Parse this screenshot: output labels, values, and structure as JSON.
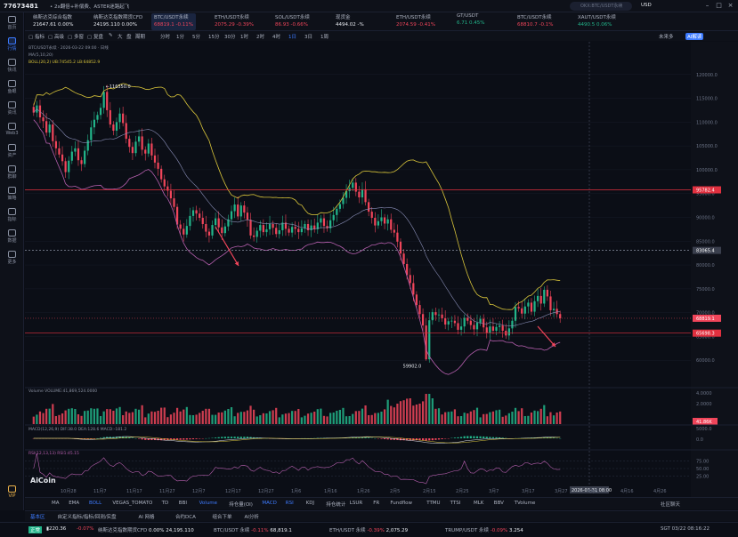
{
  "titlebar": {
    "account": "77673481",
    "notice": "• 2x翻倍+补偿费、ASTER迷路起飞",
    "search_placeholder": "OKX:BTC/USDT永续",
    "currency": "USD"
  },
  "sidebar": {
    "items": [
      {
        "label": "首页",
        "icon": "home-icon"
      },
      {
        "label": "行情",
        "icon": "chart-icon",
        "active": true
      },
      {
        "label": "快讯",
        "icon": "news-icon"
      },
      {
        "label": "鱼眼",
        "icon": "eye-icon"
      },
      {
        "label": "资讯",
        "icon": "doc-icon"
      },
      {
        "label": "Web3",
        "icon": "web3-icon"
      },
      {
        "label": "资产",
        "icon": "wallet-icon"
      },
      {
        "label": "群聊",
        "icon": "chat-icon"
      },
      {
        "label": "策略",
        "icon": "strategy-icon"
      },
      {
        "label": "指标",
        "icon": "indicator-icon"
      },
      {
        "label": "数据",
        "icon": "data-icon"
      },
      {
        "label": "更多",
        "icon": "more-icon"
      }
    ],
    "vip": "VIP"
  },
  "tickers": [
    {
      "name": "纳斯达克综合指数",
      "value": "21647.61",
      "change": "0.00%",
      "trend": "wt"
    },
    {
      "name": "纳斯达克指数期货CFD",
      "value": "24195.110",
      "change": "0.00%",
      "trend": "wt"
    },
    {
      "name": "BTC/USDT永续",
      "value": "68819.1",
      "change": "-0.11%",
      "trend": "dn",
      "active": true
    },
    {
      "name": "ETH/USDT永续",
      "value": "2075.29",
      "change": "-0.39%",
      "trend": "dn"
    },
    {
      "name": "SOL/USDT永续",
      "value": "86.93",
      "change": "-0.66%",
      "trend": "dn"
    },
    {
      "name": "现货金",
      "value": "4494.02",
      "change": "-%",
      "trend": "wt"
    },
    {
      "name": "ETH/USDT永续",
      "value": "2074.59",
      "change": "-0.41%",
      "trend": "dn"
    },
    {
      "name": "GT/USDT",
      "value": "6.71",
      "change": "0.45%",
      "trend": "up"
    },
    {
      "name": "BTC/USDT永续",
      "value": "68810.7",
      "change": "-0.1%",
      "trend": "dn"
    },
    {
      "name": "XAUT/USDT永续",
      "value": "4490.5",
      "change": "0.06%",
      "trend": "up"
    }
  ],
  "toolbar": {
    "indicators": "指标",
    "advanced": "高级",
    "multi": "多窗",
    "replay": "复盘",
    "period": "周期",
    "intervals": [
      "分时",
      "1分",
      "5分",
      "15分",
      "30分",
      "1时",
      "2时",
      "4时",
      "1日",
      "3日",
      "1周"
    ],
    "selected": "1日",
    "right_opts": [
      "未来多",
      "AI解读"
    ]
  },
  "chart": {
    "symbol_line": "BTC/USDT永续 · 2026-03-22 09:00 · 日线",
    "ma_line": "MA(5,10,20)",
    "boll_line": "BOLL(20,2) UB:74545.2 LB:64852.9",
    "price_ticks": [
      "120000.0",
      "115000.0",
      "110000.0",
      "105000.0",
      "100000.0",
      "95000.0",
      "90000.0",
      "85000.0",
      "80000.0",
      "75000.0",
      "70000.0",
      "65000.0",
      "60000.0"
    ],
    "x_ticks": [
      "10月28",
      "11月7",
      "11月17",
      "11月27",
      "12月7",
      "12月17",
      "12月27",
      "1月6",
      "1月16",
      "1月26",
      "2月5",
      "2月15",
      "2月25",
      "3月7",
      "3月17",
      "3月27",
      "4月6",
      "4月16",
      "4月26"
    ],
    "hi_label": "116350.0",
    "lo_label": "59902.0",
    "level_label_1": "95782.4",
    "level_label_2": "83065.4",
    "price_now": "68819.1",
    "level_label_3": "65698.3",
    "cursor_date": "2026-03-31 08:00",
    "volume_legend": "Volume  VOLUME:41,869,524.0000",
    "volume_ticks": [
      "4.0000",
      "2.0000"
    ],
    "volume_tag": "41.86K",
    "macd_legend": "MACD(12,26,9)  DIF:38.0  DEA:128.6  MACD:-181.2",
    "macd_ticks": [
      "5000.0",
      "0.0"
    ],
    "rsi_legend": "RSI(12,13,13)  RSI1:45.15",
    "rsi_ticks": [
      "75.00",
      "50.00",
      "25.00"
    ],
    "logo": "AiCoin",
    "watermark": "AiCoin"
  },
  "chart_data": {
    "type": "candlestick",
    "title": "BTC/USDT永续",
    "interval": "1日",
    "ylim": [
      55000,
      125000
    ],
    "closes": [
      112000,
      113500,
      111000,
      110200,
      107800,
      109500,
      106000,
      104500,
      103200,
      101800,
      99500,
      101900,
      103800,
      104500,
      102000,
      101200,
      104000,
      106200,
      108900,
      110500,
      111500,
      113000,
      116350,
      112500,
      109500,
      108200,
      110000,
      111800,
      109800,
      106500,
      104800,
      103500,
      105900,
      107000,
      104200,
      103400,
      105500,
      103000,
      101500,
      100200,
      98000,
      96500,
      95600,
      94000,
      92200,
      88500,
      87600,
      86400,
      88200,
      90300,
      91500,
      90800,
      89900,
      88600,
      87000,
      86200,
      88400,
      89800,
      87900,
      86700,
      88100,
      89600,
      91300,
      92700,
      90200,
      92500,
      91000,
      89500,
      86200,
      85900,
      87200,
      88400,
      86900,
      87500,
      88600,
      87800,
      86500,
      87300,
      88900,
      87600,
      86800,
      88000,
      87600,
      86900,
      87700,
      88600,
      87300,
      88300,
      87500,
      88900,
      89800,
      88200,
      87700,
      89400,
      90500,
      91800,
      92800,
      94100,
      95500,
      96200,
      97300,
      95400,
      94200,
      95900,
      93200,
      91200,
      89900,
      88300,
      89200,
      90000,
      88700,
      89600,
      87400,
      86800,
      84900,
      82400,
      80200,
      77900,
      76200,
      73800,
      71600,
      69700,
      67300,
      60200,
      68400,
      70100,
      69500,
      69600,
      68800,
      67500,
      68200,
      68300,
      67800,
      66400,
      67100,
      68900,
      68300,
      67400,
      66500,
      67900,
      68700,
      66900,
      65800,
      67100,
      66200,
      67000,
      67300,
      66200,
      65200,
      66700,
      68300,
      71200,
      70900,
      69800,
      71300,
      72100,
      70200,
      72400,
      73500,
      71900,
      74800,
      73400,
      70500,
      70800,
      69700,
      68819
    ],
    "hline_levels": [
      95782.4,
      83065.4,
      65698.3
    ],
    "annotations": [
      {
        "label": "116350.0",
        "kind": "high"
      },
      {
        "label": "59902.0",
        "kind": "low"
      }
    ]
  },
  "indicator_tabs": [
    "MA",
    "EMA",
    "BOLL",
    "VEGAS_TOMATO",
    "TD",
    "BBI",
    "Volume",
    "持仓量(OI)",
    "MACD",
    "RSI",
    "KDJ",
    "持仓统计",
    "LSUR",
    "FR",
    "Fundflow",
    "TTMU",
    "TTSI",
    "MLK",
    "BBV",
    "TVolume"
  ],
  "indicator_selected": [
    "BOLL",
    "Volume",
    "MACD",
    "RSI"
  ],
  "bottom_tabs": [
    "基本区",
    "自定义指标/指标/回测/实盘",
    "AI 网格",
    "合约DCA",
    "组合下单",
    "AI分析"
  ],
  "bottom_right": "社区聊天",
  "status": {
    "mode": "正常",
    "price": "220.36",
    "change": "-0.07%",
    "items": [
      {
        "name": "纳斯达克指数期货CFD",
        "change": "0.00%",
        "value": "24,195.110"
      },
      {
        "name": "BTC/USDT 永续",
        "change": "-0.11%",
        "value": "68,819.1"
      },
      {
        "name": "ETH/USDT 永续",
        "change": "-0.39%",
        "value": "2,075.29"
      },
      {
        "name": "TRUMP/USDT 永续",
        "change": "-0.09%",
        "value": "3.254"
      }
    ],
    "clock": "SGT 03/22 08:16:22"
  }
}
